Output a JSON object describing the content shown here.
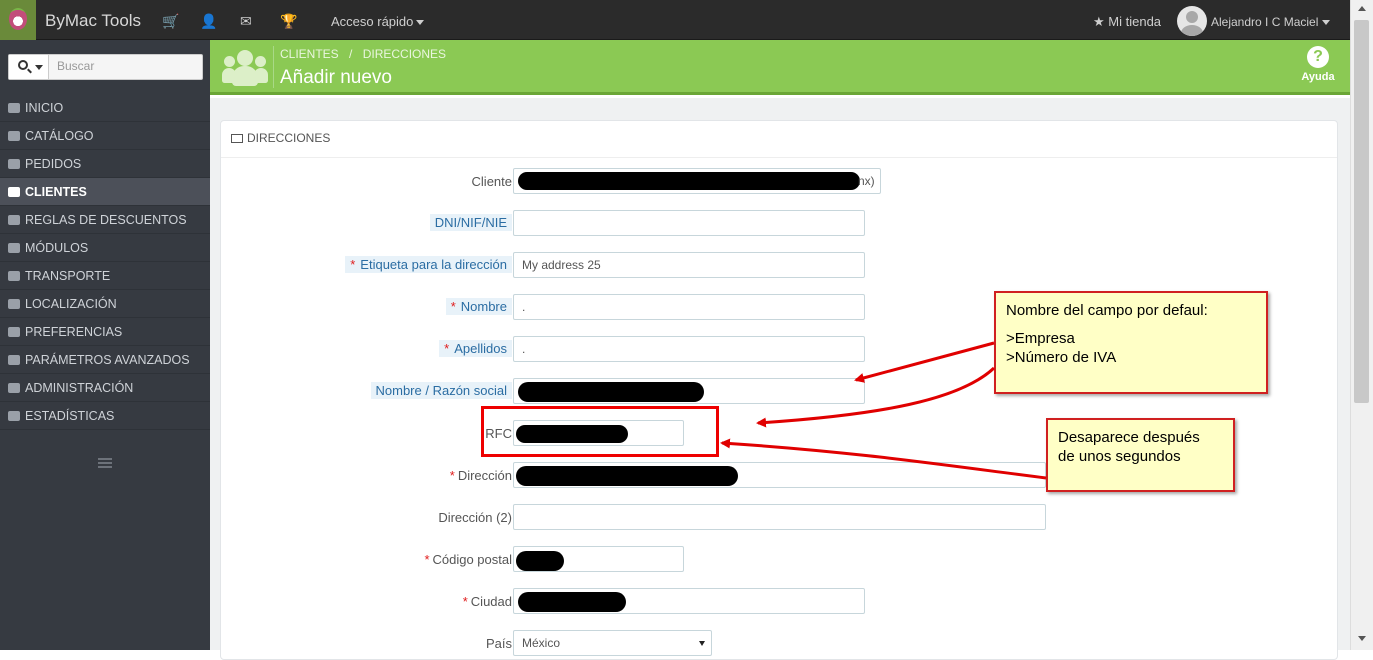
{
  "app": {
    "brand": "ByMac Tools"
  },
  "topbar": {
    "quick_access": "Acceso rápido",
    "my_store": "Mi tienda",
    "user_name": "Alejandro I C Maciel"
  },
  "sidebar": {
    "search_placeholder": "Buscar",
    "items": [
      {
        "label": "INICIO",
        "icon": "dashboard-icon"
      },
      {
        "label": "CATÁLOGO",
        "icon": "book-icon"
      },
      {
        "label": "PEDIDOS",
        "icon": "credit-card-icon"
      },
      {
        "label": "CLIENTES",
        "icon": "users-icon",
        "active": true
      },
      {
        "label": "REGLAS DE DESCUENTOS",
        "icon": "tags-icon"
      },
      {
        "label": "MÓDULOS",
        "icon": "puzzle-icon"
      },
      {
        "label": "TRANSPORTE",
        "icon": "truck-icon"
      },
      {
        "label": "LOCALIZACIÓN",
        "icon": "globe-icon"
      },
      {
        "label": "PREFERENCIAS",
        "icon": "wrench-icon"
      },
      {
        "label": "PARÁMETROS AVANZADOS",
        "icon": "cogs-icon"
      },
      {
        "label": "ADMINISTRACIÓN",
        "icon": "cog-icon"
      },
      {
        "label": "ESTADÍSTICAS",
        "icon": "bar-chart-icon"
      }
    ]
  },
  "header": {
    "breadcrumb_1": "CLIENTES",
    "breadcrumb_sep": "/",
    "breadcrumb_2": "DIRECCIONES",
    "title": "Añadir nuevo",
    "help_label": "Ayuda"
  },
  "panel": {
    "title": "DIRECCIONES",
    "fields": {
      "cliente": {
        "label": "Cliente",
        "value_suffix": "nx)"
      },
      "dni": {
        "label": "DNI/NIF/NIE",
        "value": ""
      },
      "alias": {
        "label": "Etiqueta para la dirección",
        "value": "My address 25"
      },
      "nombre": {
        "label": "Nombre",
        "value": "."
      },
      "apellidos": {
        "label": "Apellidos",
        "value": "."
      },
      "razon": {
        "label": "Nombre / Razón social"
      },
      "rfc": {
        "label": "RFC"
      },
      "direccion": {
        "label": "Dirección"
      },
      "direccion2": {
        "label": "Dirección (2)",
        "value": ""
      },
      "cp": {
        "label": "Código postal"
      },
      "ciudad": {
        "label": "Ciudad"
      },
      "pais": {
        "label": "País",
        "value": "México"
      }
    }
  },
  "annotations": {
    "callout1": {
      "title": "Nombre del campo por defaul:",
      "line1": ">Empresa",
      "line2": ">Número de IVA"
    },
    "callout2": {
      "line1": "Desaparece después",
      "line2": "de unos segundos"
    },
    "color": "#e00000"
  }
}
